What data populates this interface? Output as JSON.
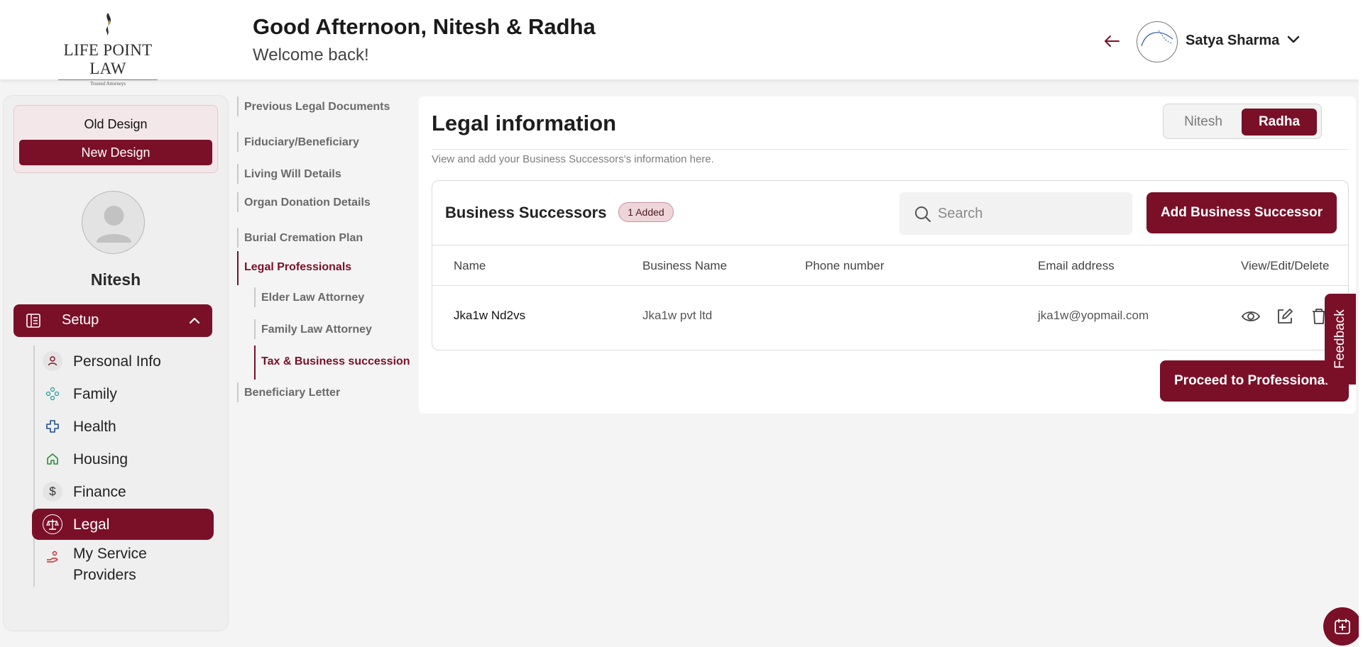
{
  "header": {
    "logo_text": "LIFE POINT LAW",
    "logo_tagline": "Trusted Attorneys",
    "greeting": "Good Afternoon, Nitesh & Radha",
    "welcome": "Welcome back!",
    "user_name": "Satya Sharma",
    "icons": {
      "back": "arrow-left-icon",
      "menu": "chevron-down-icon"
    }
  },
  "sidebar": {
    "design_old": "Old Design",
    "design_new": "New Design",
    "profile_name": "Nitesh",
    "setup_label": "Setup",
    "items": [
      {
        "label": "Personal Info",
        "icon": "person-icon"
      },
      {
        "label": "Family",
        "icon": "family-icon"
      },
      {
        "label": "Health",
        "icon": "health-cross-icon"
      },
      {
        "label": "Housing",
        "icon": "home-icon"
      },
      {
        "label": "Finance",
        "icon": "dollar-icon"
      },
      {
        "label": "Legal",
        "icon": "scales-icon",
        "active": true
      },
      {
        "label": "My Service Providers",
        "icon": "service-provider-icon"
      }
    ]
  },
  "subnav": {
    "items": [
      {
        "label": "Previous Legal Documents"
      },
      {
        "label": "Fiduciary/Beneficiary"
      },
      {
        "label": "Living Will Details"
      },
      {
        "label": "Organ Donation Details"
      },
      {
        "label": "Burial Cremation Plan"
      },
      {
        "label": "Legal Professionals",
        "active": true
      },
      {
        "label": "Elder Law Attorney",
        "level": 2
      },
      {
        "label": "Family Law Attorney",
        "level": 2
      },
      {
        "label": "Tax & Business succession",
        "level": 2,
        "active": true
      },
      {
        "label": "Beneficiary Letter"
      }
    ]
  },
  "main": {
    "title": "Legal information",
    "toggle": {
      "option1": "Nitesh",
      "option2": "Radha",
      "selected": "Radha"
    },
    "subtitle": "View and add your Business Successors's information here.",
    "table": {
      "title": "Business Successors",
      "badge": "1 Added",
      "search_placeholder": "Search",
      "add_button": "Add Business Successor",
      "columns": [
        "Name",
        "Business Name",
        "Phone number",
        "Email address",
        "View/Edit/Delete"
      ],
      "rows": [
        {
          "name": "Jka1w Nd2vs",
          "business": "Jka1w pvt ltd",
          "phone": "",
          "email": "jka1w@yopmail.com"
        }
      ]
    },
    "proceed_button": "Proceed to Professionals"
  },
  "feedback": "Feedback",
  "colors": {
    "primary": "#7a1028",
    "badge_bg": "#eed5da",
    "background": "#f4f4f4"
  }
}
